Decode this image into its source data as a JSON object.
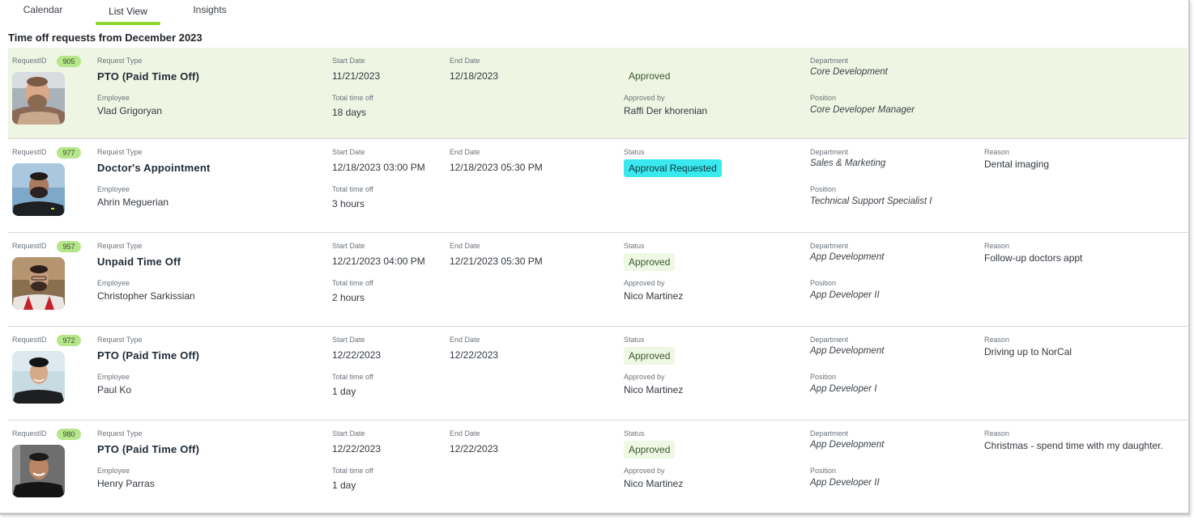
{
  "tabs": [
    {
      "label": "Calendar",
      "active": false
    },
    {
      "label": "List View",
      "active": true
    },
    {
      "label": "Insights",
      "active": false
    }
  ],
  "accent_color": "#8fd631",
  "page_title": "Time off requests from December 2023",
  "field_labels": {
    "request_id": "RequestID",
    "request_type": "Request Type",
    "start_date": "Start Date",
    "end_date": "End Date",
    "status": "Status",
    "department": "Department",
    "reason": "Reason",
    "employee": "Employee",
    "total_time_off": "Total time off",
    "approved_by": "Approved by",
    "position": "Position"
  },
  "requests": [
    {
      "id": "905",
      "type": "PTO (Paid Time Off)",
      "start": "11/21/2023",
      "end": "12/18/2023",
      "status": "Approved",
      "department": "Core Development",
      "reason": "",
      "employee": "Vlad Grigoryan",
      "total": "18 days",
      "approved_by": "Raffi Der khorenian",
      "position": "Core Developer Manager",
      "selected": true
    },
    {
      "id": "977",
      "type": "Doctor's Appointment",
      "start": "12/18/2023 03:00 PM",
      "end": "12/18/2023 05:30 PM",
      "status": "Approval Requested",
      "department": "Sales & Marketing",
      "reason": "Dental imaging",
      "employee": "Ahrin Meguerian",
      "total": "3 hours",
      "approved_by": "",
      "position": "Technical Support Specialist I",
      "selected": false
    },
    {
      "id": "957",
      "type": "Unpaid Time Off",
      "start": "12/21/2023 04:00 PM",
      "end": "12/21/2023 05:30 PM",
      "status": "Approved",
      "department": "App Development",
      "reason": "Follow-up doctors appt",
      "employee": "Christopher Sarkissian",
      "total": "2 hours",
      "approved_by": "Nico Martinez",
      "position": "App Developer II",
      "selected": false
    },
    {
      "id": "972",
      "type": "PTO (Paid Time Off)",
      "start": "12/22/2023",
      "end": "12/22/2023",
      "status": "Approved",
      "department": "App Development",
      "reason": "Driving up to NorCal",
      "employee": "Paul Ko",
      "total": "1 day",
      "approved_by": "Nico Martinez",
      "position": "App Developer I",
      "selected": false
    },
    {
      "id": "980",
      "type": "PTO (Paid Time Off)",
      "start": "12/22/2023",
      "end": "12/22/2023",
      "status": "Approved",
      "department": "App Development",
      "reason": "Christmas - spend time with my daughter.",
      "employee": "Henry Parras",
      "total": "1 day",
      "approved_by": "Nico Martinez",
      "position": "App Developer II",
      "selected": false
    }
  ]
}
